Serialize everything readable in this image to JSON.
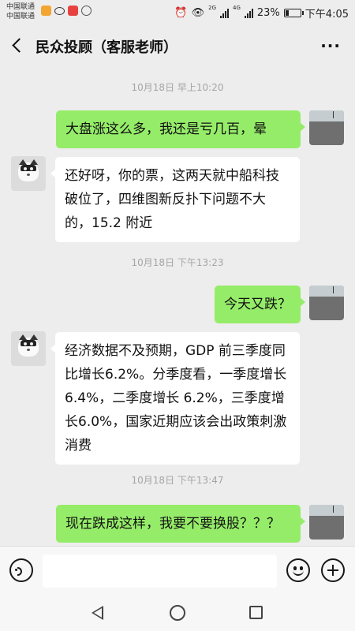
{
  "status_bar": {
    "carrier_line1": "中国联通",
    "carrier_line2": "中国联通",
    "net1": "2G",
    "net2": "4G",
    "battery": "23%",
    "battery_level": 0.23,
    "time": "下午4:05"
  },
  "header": {
    "title": "民众投顾（客服老师）",
    "more_label": "···"
  },
  "messages": [
    {
      "timestamp": "10月18日 早上10:20"
    },
    {
      "text": "大盘涨这么多，我还是亏几百，晕"
    },
    {
      "text": "还好呀，你的票，这两天就中船科技破位了，四维图新反扑下问题不大的，15.2 附近"
    },
    {
      "timestamp": "10月18日 下午13:23"
    },
    {
      "text": "今天又跌？"
    },
    {
      "text": "经济数据不及预期，GDP 前三季度同比增长6.2%。分季度看，一季度增长 6.4%，二季度增长 6.2%，三季度增长6.0%，国家近期应该会出政策刺激消费"
    },
    {
      "timestamp": "10月18日 下午13:47"
    },
    {
      "text": "现在跌成这样，我要不要换股？？？"
    }
  ],
  "input": {
    "value": "",
    "placeholder": ""
  },
  "colors": {
    "background": "#ededed",
    "my_bubble": "#95ec69",
    "their_bubble": "#ffffff"
  }
}
